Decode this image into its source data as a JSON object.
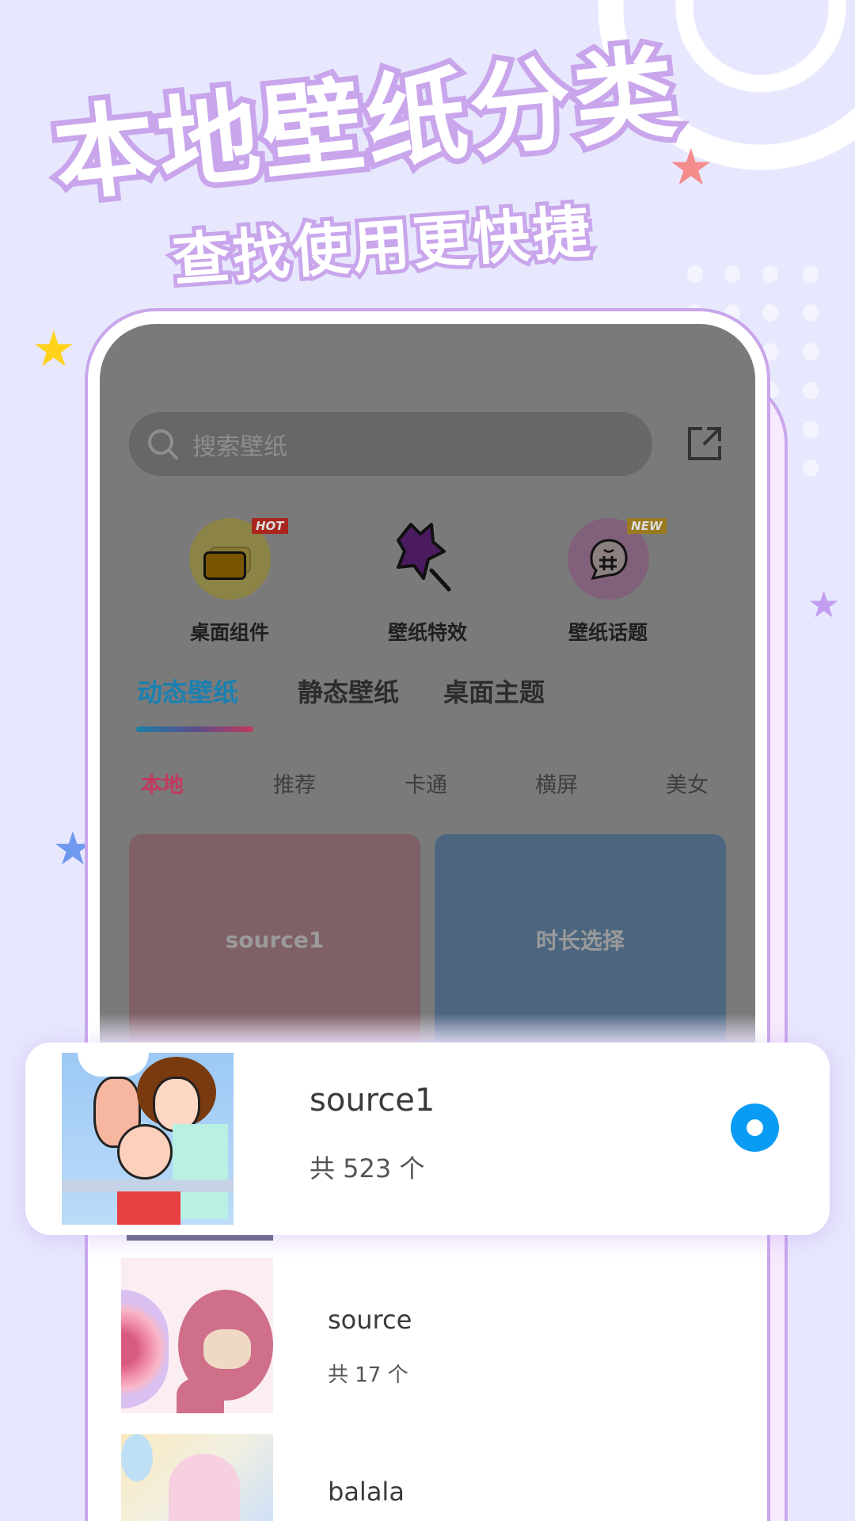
{
  "promo": {
    "headline": "本地壁纸分类",
    "subheadline": "查找使用更快捷"
  },
  "colors": {
    "background": "#e7e8fd",
    "frame": "#c9a6ec",
    "active_tab": "#1a80b2",
    "active_subtab": "#c23a5c",
    "radio": "#0a9cf5"
  },
  "search": {
    "placeholder": "搜索壁纸",
    "icon": "search-icon",
    "share_icon": "external-link-icon"
  },
  "features": [
    {
      "label": "桌面组件",
      "badge": "HOT",
      "icon": "widget-icon"
    },
    {
      "label": "壁纸特效",
      "badge": "",
      "icon": "star-wand-icon"
    },
    {
      "label": "壁纸话题",
      "badge": "NEW",
      "icon": "hashtag-bubble-icon"
    }
  ],
  "tabs": [
    {
      "label": "动态壁纸",
      "active": true
    },
    {
      "label": "静态壁纸",
      "active": false
    },
    {
      "label": "桌面主题",
      "active": false
    }
  ],
  "subtabs": [
    {
      "label": "本地",
      "active": true
    },
    {
      "label": "推荐",
      "active": false
    },
    {
      "label": "卡通",
      "active": false
    },
    {
      "label": "横屏",
      "active": false
    },
    {
      "label": "美女",
      "active": false
    }
  ],
  "cards": [
    {
      "label": "source1",
      "color": "#7f6066"
    },
    {
      "label": "时长选择",
      "color": "#4c6680"
    }
  ],
  "selected_source": {
    "name": "source1",
    "count": "共 523 个",
    "selected": true
  },
  "sources": [
    {
      "name": "source",
      "count": "共 17 个"
    },
    {
      "name": "balala",
      "count": ""
    }
  ]
}
